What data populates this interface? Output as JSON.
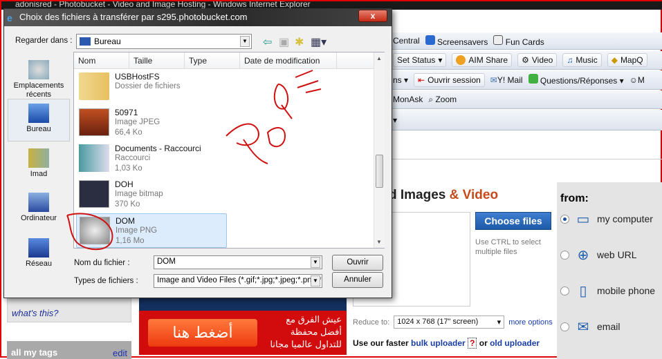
{
  "browser": {
    "window_title": "adonisred - Photobucket - Video and Image Hosting - Windows Internet Explorer",
    "toolbar1": [
      "Central",
      "Screensavers",
      "Fun Cards"
    ],
    "toolbar2": [
      "Set Status",
      "AIM Share",
      "Video",
      "Music",
      "MapQ"
    ],
    "toolbar3": [
      "ns",
      "Ouvrir session",
      "Y! Mail",
      "Questions/Réponses",
      "M"
    ],
    "toolbar4": [
      "MonAsk",
      "Zoom"
    ]
  },
  "page": {
    "heading": "d Images ",
    "heading_accent": "& Video",
    "choose_files": "Choose files",
    "ctrl_hint": "Use CTRL to select multiple files",
    "from_label": "from:",
    "sources": [
      {
        "label": "my computer",
        "icon": "laptop-icon",
        "selected": true
      },
      {
        "label": "web URL",
        "icon": "globe-icon",
        "selected": false
      },
      {
        "label": "mobile phone",
        "icon": "mobile-phone-icon",
        "selected": false
      },
      {
        "label": "email",
        "icon": "envelope-icon",
        "selected": false
      }
    ],
    "reduce_label": "Reduce to:",
    "reduce_value": "1024 x 768 (17\" screen)",
    "more_options": "more options",
    "faster_prefix": "Use our faster ",
    "bulk_uploader": "bulk uploader",
    "help_mark": "?",
    "or": " or ",
    "old_uploader": "old uploader",
    "whats_this": "what's this?",
    "all_my_tags": "all my tags",
    "edit": "edit",
    "ad_button": "أضغط هنا",
    "ad_text": "عيش الفرق مع أفضل محفظة للتداول عالميا مجانا"
  },
  "dialog": {
    "title": "Choix des fichiers à transférer par s295.photobucket.com",
    "close": "x",
    "look_in_label": "Regarder dans :",
    "look_in_value": "Bureau",
    "places": [
      "Emplacements récents",
      "Bureau",
      "Imad",
      "Ordinateur",
      "Réseau"
    ],
    "columns": [
      "Nom",
      "Taille",
      "Type",
      "Date de modification"
    ],
    "files": [
      {
        "name": "USBHostFS",
        "type": "Dossier de fichiers",
        "size": ""
      },
      {
        "name": "50971",
        "type": "Image JPEG",
        "size": "66,4 Ko"
      },
      {
        "name": "Documents - Raccourci",
        "type": "Raccourci",
        "size": "1,03 Ko"
      },
      {
        "name": "DOH",
        "type": "Image bitmap",
        "size": "370 Ko"
      },
      {
        "name": "DOM",
        "type": "Image PNG",
        "size": "1,16 Mo",
        "selected": true
      }
    ],
    "filename_label": "Nom du fichier :",
    "filename_value": "DOM",
    "filetype_label": "Types de fichiers :",
    "filetype_value": "Image and Video Files (*.gif;*.jpg;*.jpeg;*.png;*.b",
    "open": "Ouvrir",
    "cancel": "Annuler"
  },
  "colors": {
    "annotation": "#d01010",
    "accent": "#c84a1a",
    "button": "#1d5aa8"
  }
}
